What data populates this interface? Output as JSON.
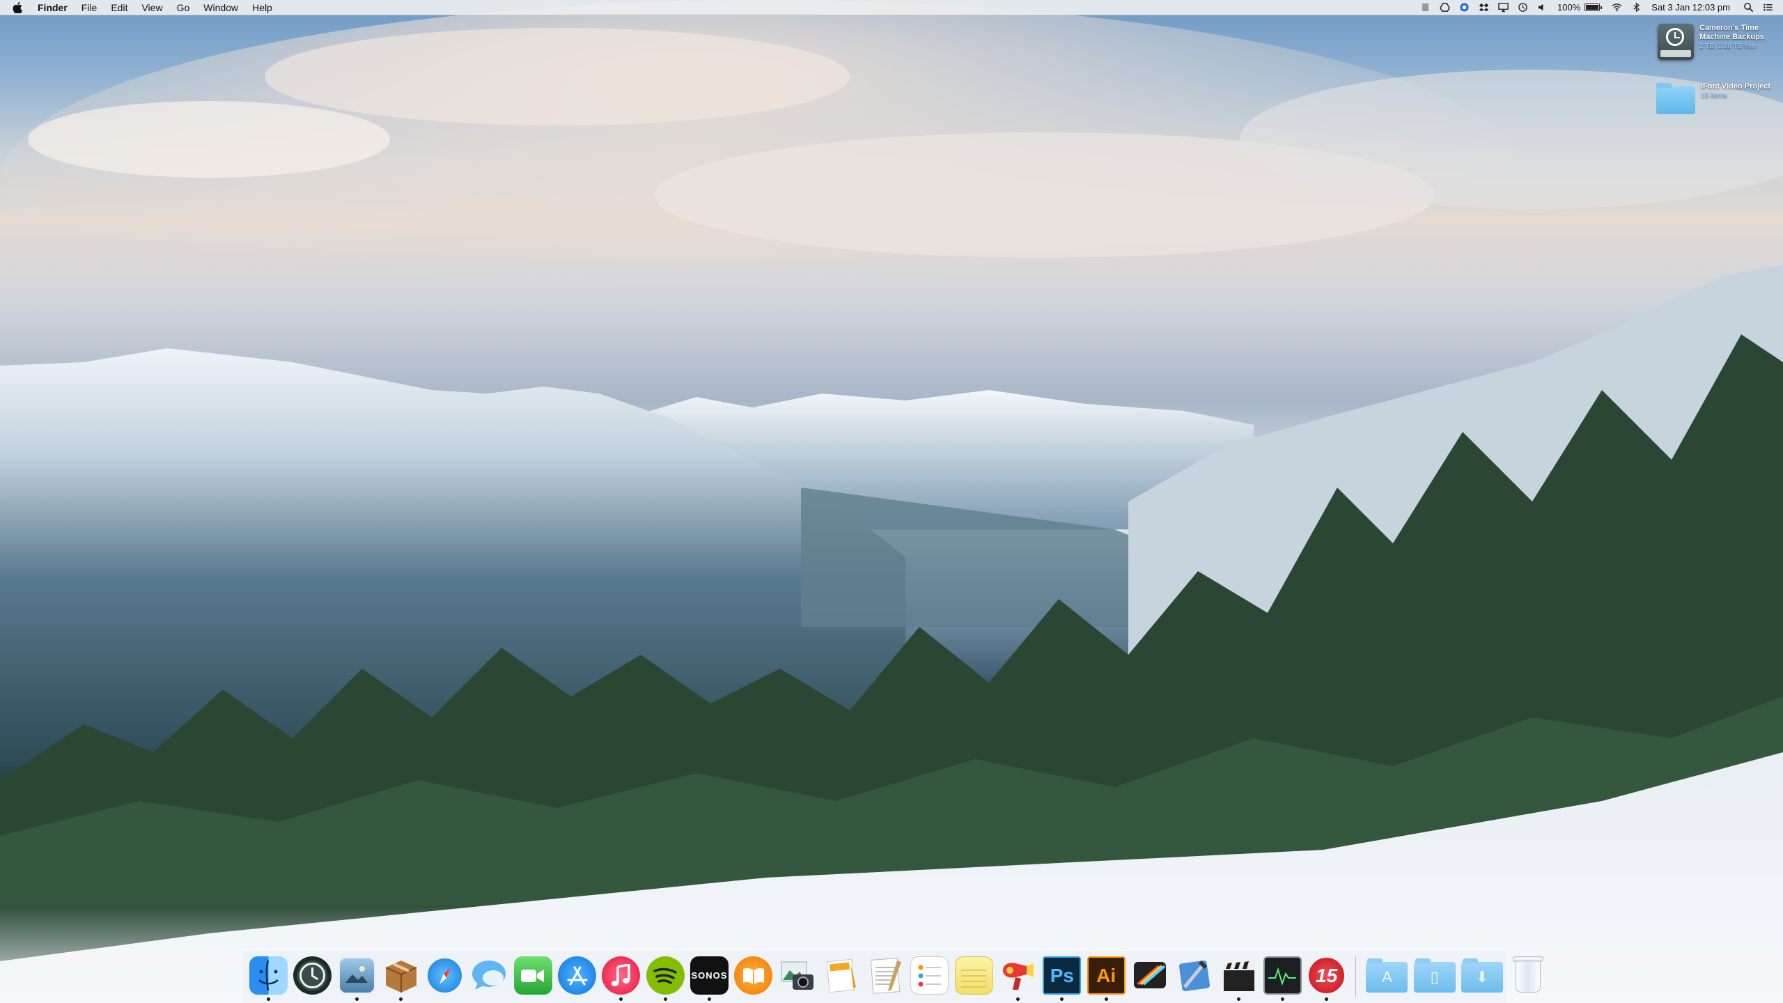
{
  "menubar": {
    "app_name": "Finder",
    "menus": [
      "File",
      "Edit",
      "View",
      "Go",
      "Window",
      "Help"
    ],
    "battery_percent": "100%",
    "battery_level": 1.0,
    "datetime": "Sat 3 Jan  12:03 pm",
    "status_icons": [
      "menu-extra-icon",
      "google-drive-icon",
      "dropbox-icon",
      "box-icon",
      "airplay-icon",
      "time-machine-icon",
      "volume-icon",
      "battery-icon",
      "wifi-icon",
      "bluetooth-icon",
      "spotlight-icon",
      "notification-center-icon"
    ]
  },
  "desktop": {
    "items": [
      {
        "name": "Cameron's Time Machine Backups",
        "meta": "2 TB, 1.38 TB free",
        "icon": "time-machine-drive-icon"
      },
      {
        "name": "iFont Video Project",
        "meta": "13 items",
        "icon": "folder-icon"
      }
    ]
  },
  "dock": {
    "apps": [
      {
        "name": "Finder",
        "icon": "finder-icon",
        "running": true
      },
      {
        "name": "Time Machine",
        "icon": "time-machine-icon",
        "running": false
      },
      {
        "name": "Preview",
        "icon": "preview-icon",
        "running": true
      },
      {
        "name": "Archive",
        "icon": "package-box-icon",
        "running": true
      },
      {
        "name": "Safari",
        "icon": "safari-compass-icon",
        "running": false
      },
      {
        "name": "Messages",
        "icon": "messages-bubble-icon",
        "running": false
      },
      {
        "name": "FaceTime",
        "icon": "facetime-camera-icon",
        "running": false
      },
      {
        "name": "App Store",
        "icon": "app-store-icon",
        "running": false
      },
      {
        "name": "iTunes",
        "icon": "itunes-note-icon",
        "running": true
      },
      {
        "name": "Spotify",
        "icon": "spotify-icon",
        "running": true
      },
      {
        "name": "Sonos",
        "icon": "sonos-icon",
        "running": true,
        "label": "SONOS"
      },
      {
        "name": "iBooks",
        "icon": "ibooks-icon",
        "running": false
      },
      {
        "name": "Image Capture",
        "icon": "image-capture-icon",
        "running": false
      },
      {
        "name": "Pages",
        "icon": "pages-icon",
        "running": false
      },
      {
        "name": "TextEdit",
        "icon": "textedit-icon",
        "running": false
      },
      {
        "name": "Reminders",
        "icon": "reminders-icon",
        "running": false
      },
      {
        "name": "Notes",
        "icon": "notes-icon",
        "running": false
      },
      {
        "name": "Transmit",
        "icon": "hair-dryer-icon",
        "running": true
      },
      {
        "name": "Photoshop",
        "icon": "photoshop-icon",
        "running": true,
        "label": "Ps"
      },
      {
        "name": "Illustrator",
        "icon": "illustrator-icon",
        "running": true,
        "label": "Ai"
      },
      {
        "name": "Final Cut Pro",
        "icon": "final-cut-icon",
        "running": false
      },
      {
        "name": "Xcode",
        "icon": "xcode-icon",
        "running": false
      },
      {
        "name": "Motion",
        "icon": "clapperboard-icon",
        "running": true
      },
      {
        "name": "Activity Monitor",
        "icon": "activity-monitor-icon",
        "running": true
      },
      {
        "name": "Fantastical",
        "icon": "calendar-15-icon",
        "running": true,
        "label": "15"
      }
    ],
    "stacks": [
      {
        "name": "Applications",
        "icon": "applications-folder-icon",
        "glyph": "A"
      },
      {
        "name": "Documents",
        "icon": "documents-folder-icon",
        "glyph": "▯"
      },
      {
        "name": "Downloads",
        "icon": "downloads-folder-icon",
        "glyph": "⬇"
      }
    ],
    "trash": {
      "name": "Trash",
      "icon": "trash-icon"
    }
  },
  "colors": {
    "accent_blue": "#1e8ef5",
    "photoshop": "#0b2a3f",
    "illustrator": "#3a1e07",
    "spotify": "#84bd00",
    "fantastical_red": "#d8202a"
  }
}
